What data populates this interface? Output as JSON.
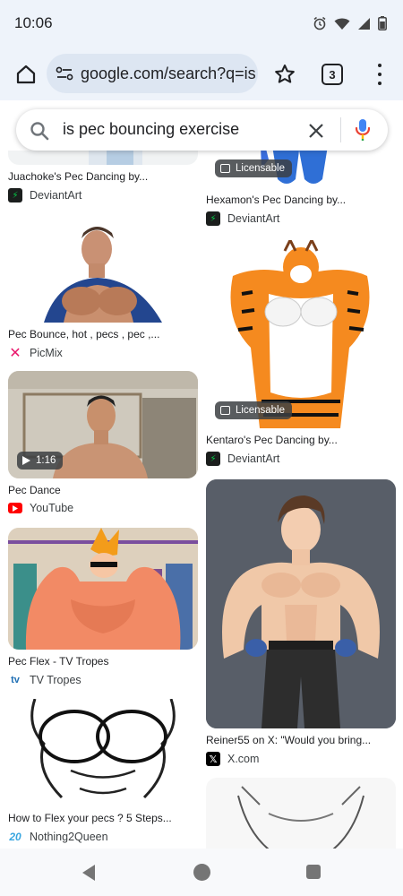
{
  "status_bar": {
    "time": "10:06",
    "icons": [
      "alarm-icon",
      "wifi-icon",
      "signal-icon",
      "battery-icon"
    ]
  },
  "browser": {
    "url": "google.com/search?q=is",
    "tab_count": "3"
  },
  "search": {
    "query": "is pec bouncing exercise"
  },
  "results": {
    "left": [
      {
        "title": "Juachoke's Pec Dancing by...",
        "source": "DeviantArt",
        "favicon": "deviantart-icon"
      },
      {
        "title": "Pec Bounce, hot , pecs , pec ,...",
        "source": "PicMix",
        "favicon": "picmix-icon"
      },
      {
        "title": "Pec Dance",
        "source": "YouTube",
        "favicon": "youtube-icon",
        "duration": "1:16"
      },
      {
        "title": "Pec Flex - TV Tropes",
        "source": "TV Tropes",
        "favicon": "tvtropes-icon"
      },
      {
        "title": "How to Flex your pecs ? 5 Steps...",
        "source": "Nothing2Queen",
        "favicon": "nothing2queen-icon"
      }
    ],
    "right": [
      {
        "title": "Hexamon's Pec Dancing by...",
        "source": "DeviantArt",
        "favicon": "deviantart-icon",
        "badge": "Licensable"
      },
      {
        "title": "Kentaro's Pec Dancing by...",
        "source": "DeviantArt",
        "favicon": "deviantart-icon",
        "badge": "Licensable"
      },
      {
        "title": "Reiner55 on X: \"Would you bring...",
        "source": "X.com",
        "favicon": "x-icon"
      }
    ]
  },
  "colors": {
    "chrome_bg": "#eef3fa",
    "omnibox_bg": "#dde6f2",
    "deviantart": "#05cc47",
    "youtube": "#ff0000",
    "picmix": "#e9176c"
  }
}
